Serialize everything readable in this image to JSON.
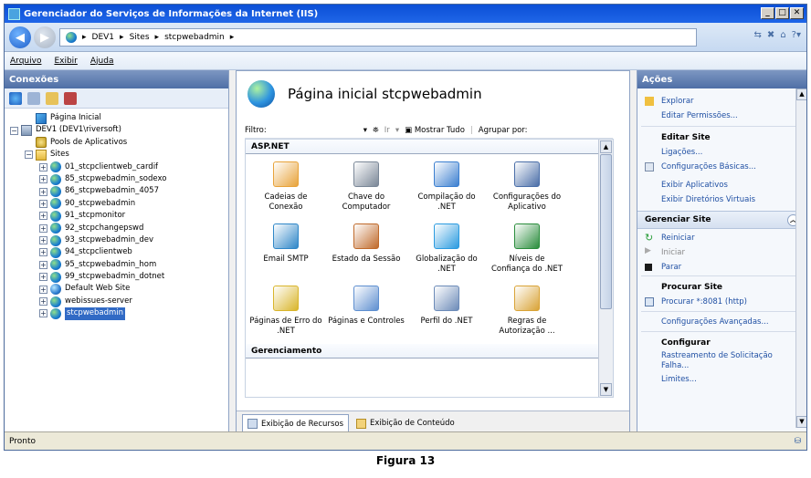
{
  "window": {
    "title": "Gerenciador do Serviços de Informações da Internet (IIS)"
  },
  "address": {
    "crumbs": [
      "DEV1",
      "Sites",
      "stcpwebadmin"
    ]
  },
  "menu": [
    "Arquivo",
    "Exibir",
    "Ajuda"
  ],
  "connections": {
    "title": "Conexões",
    "tree": [
      {
        "label": "Página Inicial",
        "icon": "home-icon",
        "level": 1
      },
      {
        "label": "DEV1 (DEV1\\riversoft)",
        "icon": "server-icon",
        "level": 0
      },
      {
        "label": "Pools de Aplicativos",
        "icon": "app-pool-icon",
        "level": 1
      },
      {
        "label": "Sites",
        "icon": "folder-icon",
        "level": 1
      },
      {
        "label": "01_stcpclientweb_cardif",
        "icon": "website-icon",
        "level": 2
      },
      {
        "label": "85_stcpwebadmin_sodexo",
        "icon": "website-icon",
        "level": 2
      },
      {
        "label": "86_stcpwebadmin_4057",
        "icon": "website-icon",
        "level": 2
      },
      {
        "label": "90_stcpwebadmin",
        "icon": "website-icon",
        "level": 2
      },
      {
        "label": "91_stcpmonitor",
        "icon": "website-icon",
        "level": 2
      },
      {
        "label": "92_stcpchangepswd",
        "icon": "website-icon",
        "level": 2
      },
      {
        "label": "93_stcpwebadmin_dev",
        "icon": "website-icon",
        "level": 2
      },
      {
        "label": "94_stcpclientweb",
        "icon": "website-icon",
        "level": 2
      },
      {
        "label": "95_stcpwebadmin_hom",
        "icon": "website-icon",
        "level": 2
      },
      {
        "label": "99_stcpwebadmin_dotnet",
        "icon": "website-icon",
        "level": 2
      },
      {
        "label": "Default Web Site",
        "icon": "default-site-icon",
        "level": 2
      },
      {
        "label": "webissues-server",
        "icon": "website-icon",
        "level": 2
      },
      {
        "label": "stcpwebadmin",
        "icon": "website-icon",
        "level": 2,
        "selected": true
      }
    ]
  },
  "main": {
    "title": "Página inicial stcpwebadmin",
    "filter_label": "Filtro:",
    "go_label": "Ir",
    "show_all_label": "Mostrar Tudo",
    "group_by_label": "Agrupar por:",
    "groups": [
      {
        "name": "ASP.NET",
        "features": [
          {
            "label": "Cadeias de Conexão",
            "icon": "connection-strings-icon",
            "color": "#e8a33a"
          },
          {
            "label": "Chave do Computador",
            "icon": "machine-key-icon",
            "color": "#7a8797"
          },
          {
            "label": "Compilação do .NET",
            "icon": "compilation-icon",
            "color": "#3b7fd0"
          },
          {
            "label": "Configurações do Aplicativo",
            "icon": "app-settings-icon",
            "color": "#4a6ea8"
          },
          {
            "label": "Email SMTP",
            "icon": "smtp-email-icon",
            "color": "#2f87c8"
          },
          {
            "label": "Estado da Sessão",
            "icon": "session-state-icon",
            "color": "#c06a2b"
          },
          {
            "label": "Globalização do .NET",
            "icon": "globalization-icon",
            "color": "#2b9be0"
          },
          {
            "label": "Níveis de Confiança do .NET",
            "icon": "trust-levels-icon",
            "color": "#2a8d3c"
          },
          {
            "label": "Páginas de Erro do .NET",
            "icon": "error-pages-icon",
            "color": "#d9b52b"
          },
          {
            "label": "Páginas e Controles",
            "icon": "pages-controls-icon",
            "color": "#5e8fd0"
          },
          {
            "label": "Perfil do .NET",
            "icon": "profile-icon",
            "color": "#6c8bb8"
          },
          {
            "label": "Regras de Autorização ...",
            "icon": "authorization-rules-icon",
            "color": "#d9a336"
          }
        ]
      },
      {
        "name": "Gerenciamento",
        "features": []
      }
    ]
  },
  "view_tabs": [
    "Exibição de Recursos",
    "Exibição de Conteúdo"
  ],
  "actions": {
    "title": "Ações",
    "top_links": [
      "Explorar",
      "Editar Permissões..."
    ],
    "edit_site": {
      "header": "Editar Site",
      "links": [
        "Ligações...",
        "Configurações Básicas...",
        "Exibir Aplicativos",
        "Exibir Diretórios Virtuais"
      ]
    },
    "manage_site": {
      "header": "Gerenciar Site",
      "restart": "Reiniciar",
      "start": "Iniciar",
      "stop": "Parar"
    },
    "browse_site": {
      "header": "Procurar Site",
      "browse": "Procurar *:8081 (http)",
      "advanced": "Configurações Avançadas..."
    },
    "configure": {
      "header": "Configurar",
      "links": [
        "Rastreamento de Solicitação Falha...",
        "Limites..."
      ]
    }
  },
  "status": "Pronto",
  "caption": "Figura 13"
}
